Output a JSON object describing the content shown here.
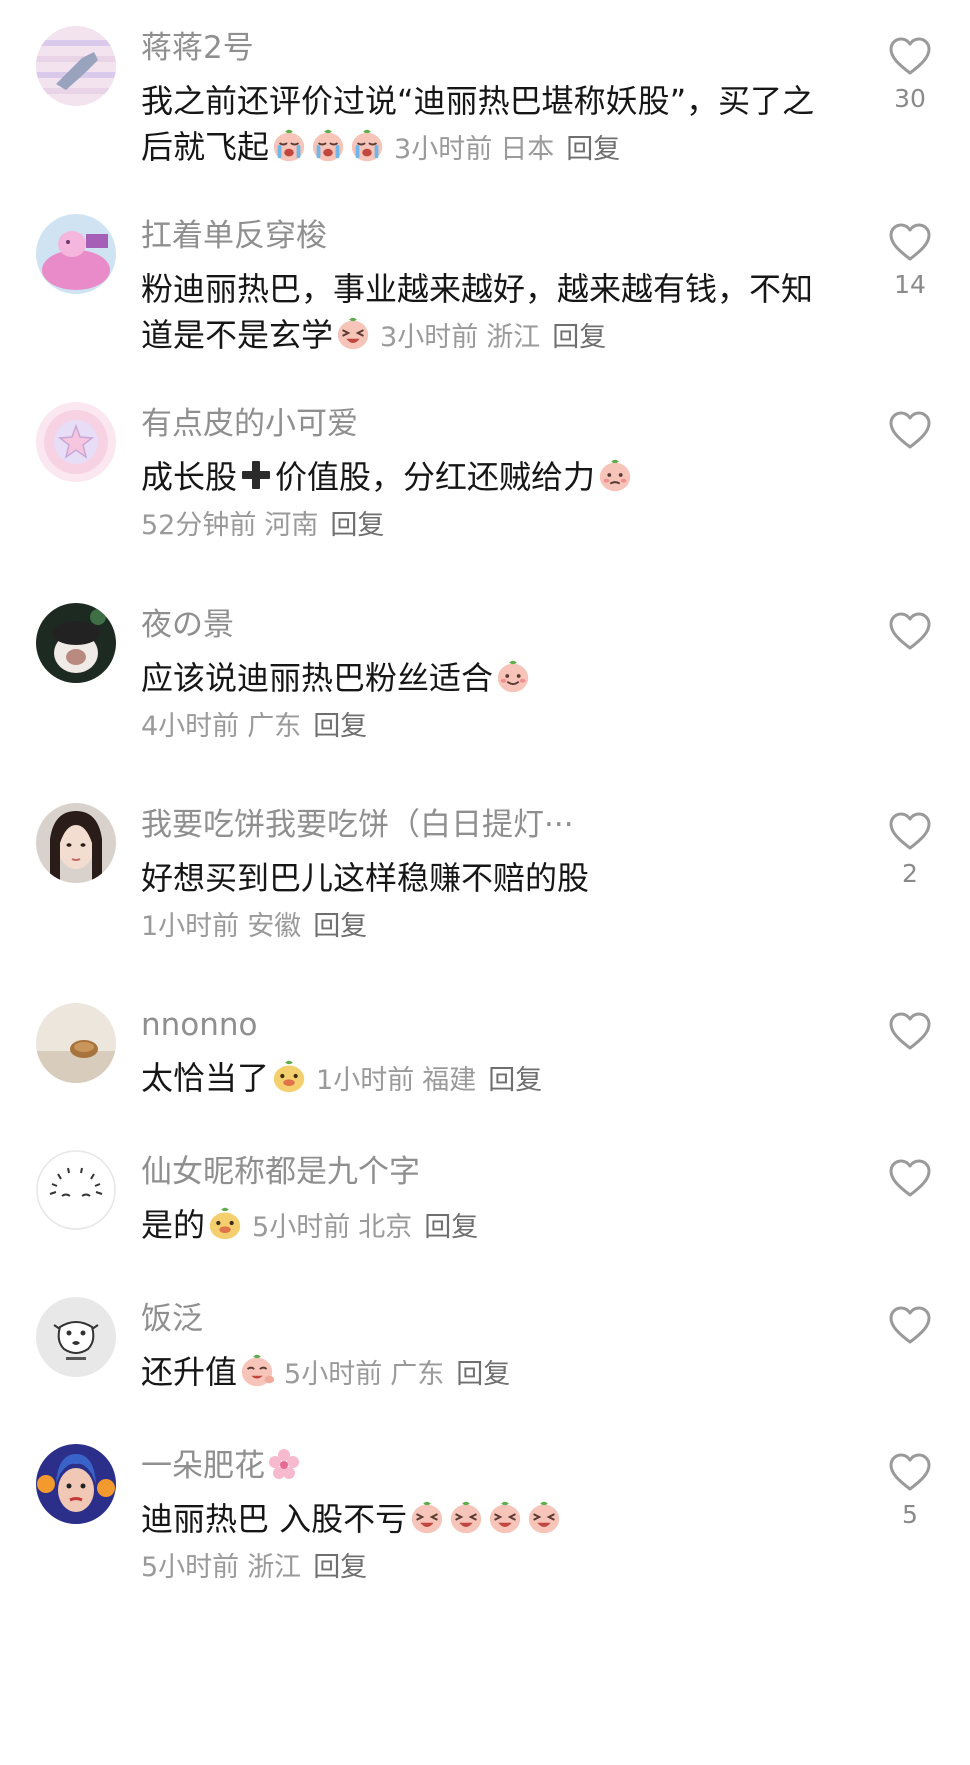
{
  "comments": [
    {
      "username": "蒋蒋2号",
      "text": "我之前还评价过说“迪丽热巴堪称妖股”，买了之后就飞起",
      "emoji": [
        "crying-face-emoji",
        "crying-face-emoji",
        "crying-face-emoji"
      ],
      "time": "3小时前",
      "location": "日本",
      "reply": "回复",
      "likes": "30"
    },
    {
      "username": "扛着单反穿梭",
      "text": "粉迪丽热巴，事业越来越好，越来越有钱，不知道是不是玄学",
      "emoji": [
        "laughing-face-emoji"
      ],
      "time": "3小时前",
      "location": "浙江",
      "reply": "回复",
      "likes": "14"
    },
    {
      "username": "有点皮的小可爱",
      "text_before": "成长股",
      "text_after": "价值股，分红还贼给力",
      "emoji": [
        "shy-face-emoji"
      ],
      "time": "52分钟前",
      "location": "河南",
      "reply": "回复",
      "likes": ""
    },
    {
      "username": "夜の景",
      "text": "应该说迪丽热巴粉丝适合",
      "emoji": [
        "smiling-face-emoji"
      ],
      "time": "4小时前",
      "location": "广东",
      "reply": "回复",
      "likes": ""
    },
    {
      "username": "我要吃饼我要吃饼（白日提灯···",
      "text": "好想买到巴儿这样稳赚不赔的股",
      "emoji": [],
      "time": "1小时前",
      "location": "安徽",
      "reply": "回复",
      "likes": "2"
    },
    {
      "username": "nnonno",
      "text": "太恰当了",
      "emoji": [
        "yellow-duck-emoji"
      ],
      "time": "1小时前",
      "location": "福建",
      "reply": "回复",
      "likes": ""
    },
    {
      "username": "仙女昵称都是九个字",
      "text": "是的",
      "emoji": [
        "yellow-duck-emoji"
      ],
      "time": "5小时前",
      "location": "北京",
      "reply": "回复",
      "likes": ""
    },
    {
      "username": "饭泛",
      "text": "还升值",
      "emoji": [
        "waving-face-emoji"
      ],
      "time": "5小时前",
      "location": "广东",
      "reply": "回复",
      "likes": ""
    },
    {
      "username": "一朵肥花",
      "text": "迪丽热巴 入股不亏",
      "emoji": [
        "laughing-face-emoji",
        "laughing-face-emoji",
        "laughing-face-emoji",
        "laughing-face-emoji"
      ],
      "time": "5小时前",
      "location": "浙江",
      "reply": "回复",
      "likes": "5"
    }
  ],
  "colors": {
    "username": "#8f8f8f",
    "body_text": "#161616",
    "meta": "#9a9a9a",
    "like_icon": "#9a9a9a",
    "emoji_face": "#f6c4b8",
    "emoji_leaf": "#5fae4e"
  }
}
